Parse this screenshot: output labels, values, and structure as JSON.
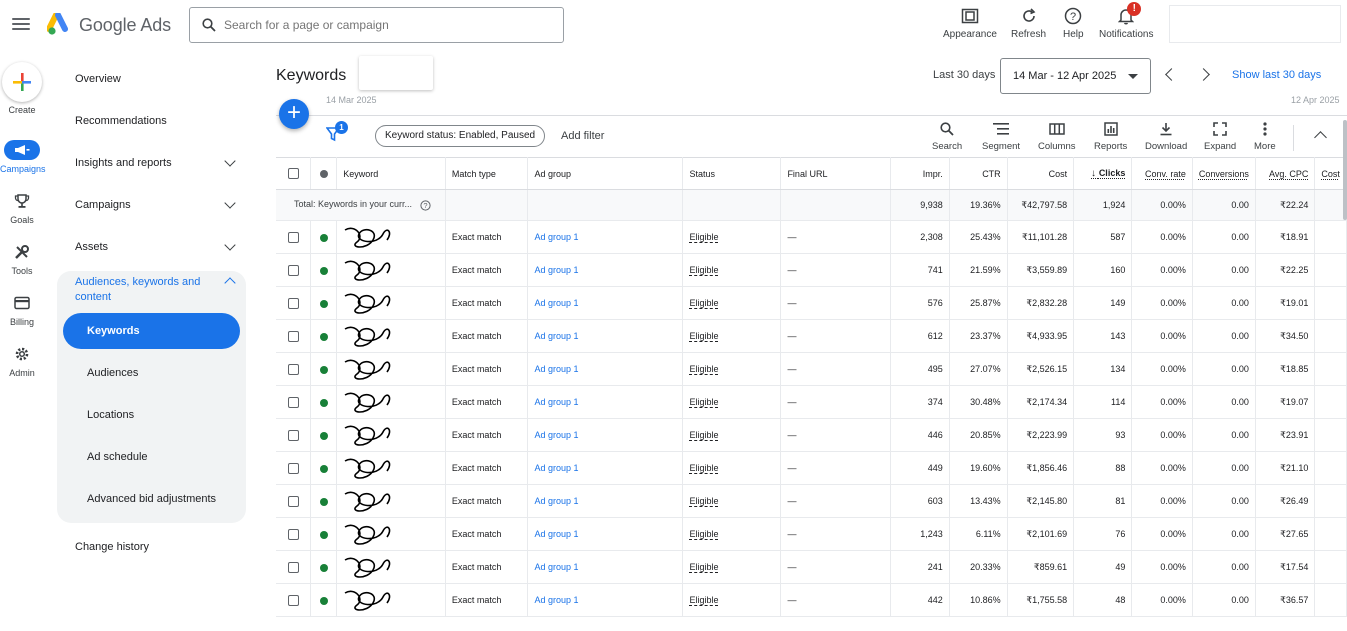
{
  "app": {
    "name": "Google Ads"
  },
  "search": {
    "placeholder": "Search for a page or campaign"
  },
  "topbar": {
    "appearance": "Appearance",
    "refresh": "Refresh",
    "help": "Help",
    "notifications": "Notifications",
    "notification_count": "!"
  },
  "rail": {
    "create": "Create",
    "campaigns": "Campaigns",
    "goals": "Goals",
    "tools": "Tools",
    "billing": "Billing",
    "admin": "Admin"
  },
  "nav": {
    "overview": "Overview",
    "recommendations": "Recommendations",
    "insights": "Insights and reports",
    "campaigns": "Campaigns",
    "assets": "Assets",
    "audiences_group": "Audiences, keywords and content",
    "keywords": "Keywords",
    "audiences": "Audiences",
    "locations": "Locations",
    "ad_schedule": "Ad schedule",
    "advanced_bid": "Advanced bid adjustments",
    "change_history": "Change history"
  },
  "header": {
    "title": "Keywords",
    "date_label": "Last 30 days",
    "date_range": "14 Mar - 12 Apr 2025",
    "show_last": "Show last 30 days"
  },
  "chart_strip": {
    "left_label": "14 Mar 2025",
    "right_label": "12 Apr 2025"
  },
  "toolbar": {
    "filter_count": "1",
    "chip": "Keyword status: Enabled, Paused",
    "add_filter": "Add filter",
    "search": "Search",
    "segment": "Segment",
    "columns": "Columns",
    "reports": "Reports",
    "download": "Download",
    "expand": "Expand",
    "more": "More"
  },
  "table": {
    "headers": {
      "keyword": "Keyword",
      "match_type": "Match type",
      "ad_group": "Ad group",
      "status": "Status",
      "final_url": "Final URL",
      "impr": "Impr.",
      "ctr": "CTR",
      "cost": "Cost",
      "clicks": "Clicks",
      "conv_rate": "Conv. rate",
      "conversions": "Conversions",
      "avg_cpc": "Avg. CPC",
      "cost_per": "Cost"
    },
    "total": {
      "label": "Total: Keywords in your curr...",
      "impr": "9,938",
      "ctr": "19.36%",
      "cost": "₹42,797.58",
      "clicks": "1,924",
      "conv_rate": "0.00%",
      "conversions": "0.00",
      "avg_cpc": "₹22.24"
    },
    "rows": [
      {
        "match": "Exact match",
        "ad_group": "Ad group 1",
        "status": "Eligible",
        "url": "—",
        "impr": "2,308",
        "ctr": "25.43%",
        "cost": "₹11,101.28",
        "clicks": "587",
        "conv_rate": "0.00%",
        "conversions": "0.00",
        "avg_cpc": "₹18.91"
      },
      {
        "match": "Exact match",
        "ad_group": "Ad group 1",
        "status": "Eligible",
        "url": "—",
        "impr": "741",
        "ctr": "21.59%",
        "cost": "₹3,559.89",
        "clicks": "160",
        "conv_rate": "0.00%",
        "conversions": "0.00",
        "avg_cpc": "₹22.25"
      },
      {
        "match": "Exact match",
        "ad_group": "Ad group 1",
        "status": "Eligible",
        "url": "—",
        "impr": "576",
        "ctr": "25.87%",
        "cost": "₹2,832.28",
        "clicks": "149",
        "conv_rate": "0.00%",
        "conversions": "0.00",
        "avg_cpc": "₹19.01"
      },
      {
        "match": "Exact match",
        "ad_group": "Ad group 1",
        "status": "Eligible",
        "url": "—",
        "impr": "612",
        "ctr": "23.37%",
        "cost": "₹4,933.95",
        "clicks": "143",
        "conv_rate": "0.00%",
        "conversions": "0.00",
        "avg_cpc": "₹34.50"
      },
      {
        "match": "Exact match",
        "ad_group": "Ad group 1",
        "status": "Eligible",
        "url": "—",
        "impr": "495",
        "ctr": "27.07%",
        "cost": "₹2,526.15",
        "clicks": "134",
        "conv_rate": "0.00%",
        "conversions": "0.00",
        "avg_cpc": "₹18.85"
      },
      {
        "match": "Exact match",
        "ad_group": "Ad group 1",
        "status": "Eligible",
        "url": "—",
        "impr": "374",
        "ctr": "30.48%",
        "cost": "₹2,174.34",
        "clicks": "114",
        "conv_rate": "0.00%",
        "conversions": "0.00",
        "avg_cpc": "₹19.07"
      },
      {
        "match": "Exact match",
        "ad_group": "Ad group 1",
        "status": "Eligible",
        "url": "—",
        "impr": "446",
        "ctr": "20.85%",
        "cost": "₹2,223.99",
        "clicks": "93",
        "conv_rate": "0.00%",
        "conversions": "0.00",
        "avg_cpc": "₹23.91"
      },
      {
        "match": "Exact match",
        "ad_group": "Ad group 1",
        "status": "Eligible",
        "url": "—",
        "impr": "449",
        "ctr": "19.60%",
        "cost": "₹1,856.46",
        "clicks": "88",
        "conv_rate": "0.00%",
        "conversions": "0.00",
        "avg_cpc": "₹21.10"
      },
      {
        "match": "Exact match",
        "ad_group": "Ad group 1",
        "status": "Eligible",
        "url": "—",
        "impr": "603",
        "ctr": "13.43%",
        "cost": "₹2,145.80",
        "clicks": "81",
        "conv_rate": "0.00%",
        "conversions": "0.00",
        "avg_cpc": "₹26.49"
      },
      {
        "match": "Exact match",
        "ad_group": "Ad group 1",
        "status": "Eligible",
        "url": "—",
        "impr": "1,243",
        "ctr": "6.11%",
        "cost": "₹2,101.69",
        "clicks": "76",
        "conv_rate": "0.00%",
        "conversions": "0.00",
        "avg_cpc": "₹27.65"
      },
      {
        "match": "Exact match",
        "ad_group": "Ad group 1",
        "status": "Eligible",
        "url": "—",
        "impr": "241",
        "ctr": "20.33%",
        "cost": "₹859.61",
        "clicks": "49",
        "conv_rate": "0.00%",
        "conversions": "0.00",
        "avg_cpc": "₹17.54"
      },
      {
        "match": "Exact match",
        "ad_group": "Ad group 1",
        "status": "Eligible",
        "url": "—",
        "impr": "442",
        "ctr": "10.86%",
        "cost": "₹1,755.58",
        "clicks": "48",
        "conv_rate": "0.00%",
        "conversions": "0.00",
        "avg_cpc": "₹36.57"
      }
    ]
  },
  "colors": {
    "accent": "#1a73e8",
    "enabled": "#188038"
  }
}
